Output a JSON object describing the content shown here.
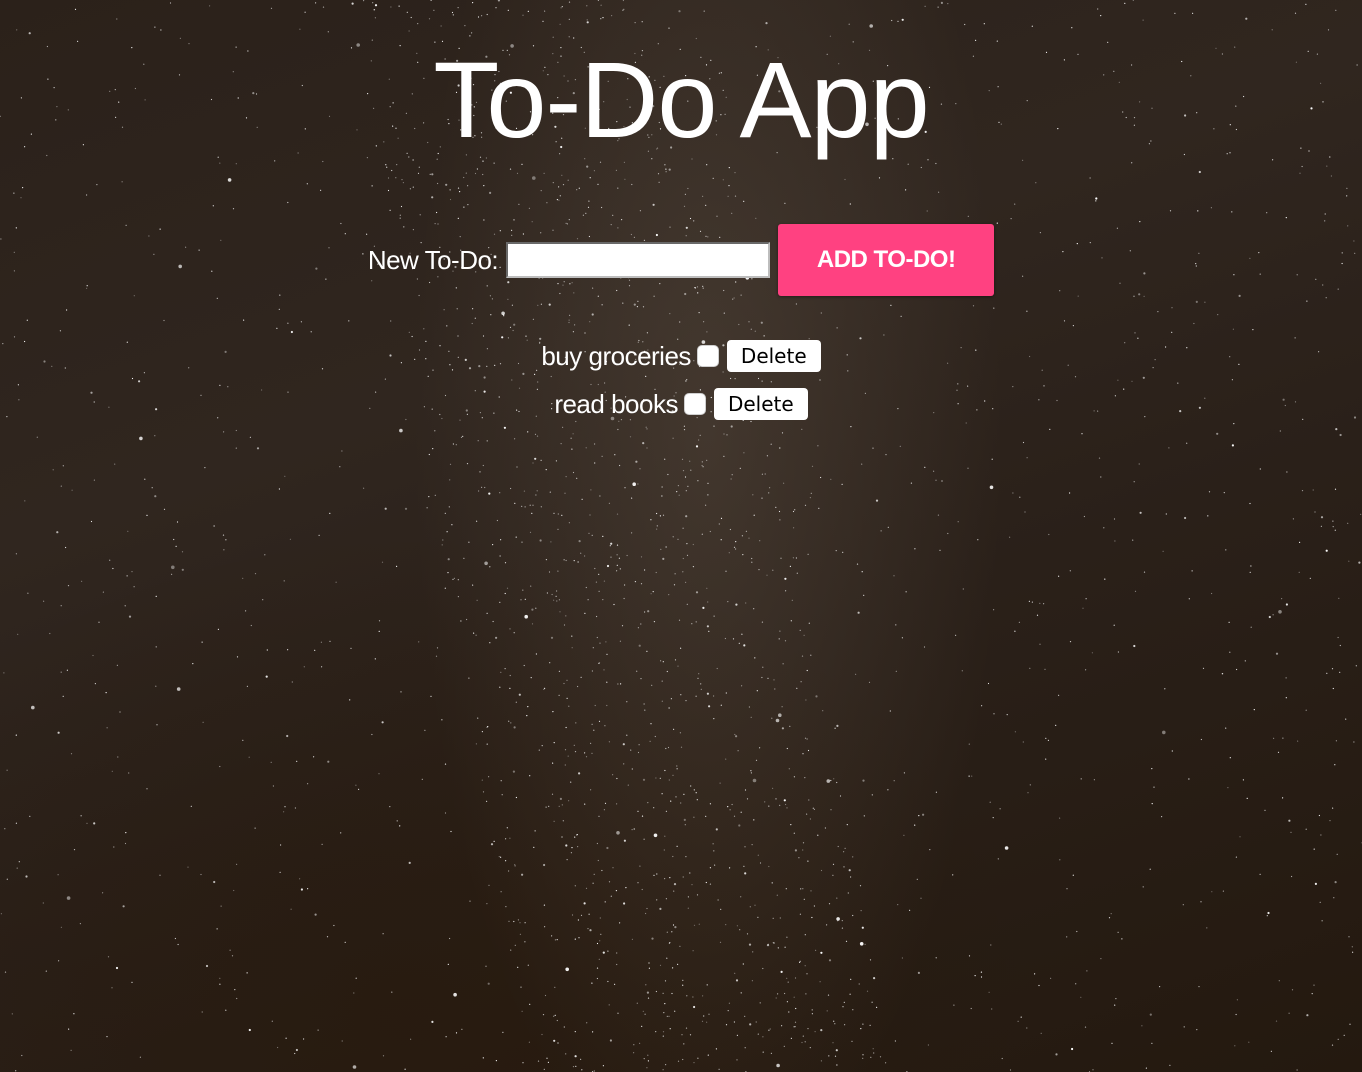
{
  "app": {
    "title": "To-Do App"
  },
  "form": {
    "label": "New To-Do:",
    "input_value": "",
    "input_placeholder": "",
    "add_label": "ADD TO-DO!"
  },
  "todos": [
    {
      "text": "buy groceries",
      "done": false,
      "delete_label": "Delete"
    },
    {
      "text": "read books",
      "done": false,
      "delete_label": "Delete"
    }
  ],
  "colors": {
    "accent": "#ff4181",
    "text": "#ffffff",
    "background": "#2b211a"
  },
  "background_image": "starry-night-sky"
}
